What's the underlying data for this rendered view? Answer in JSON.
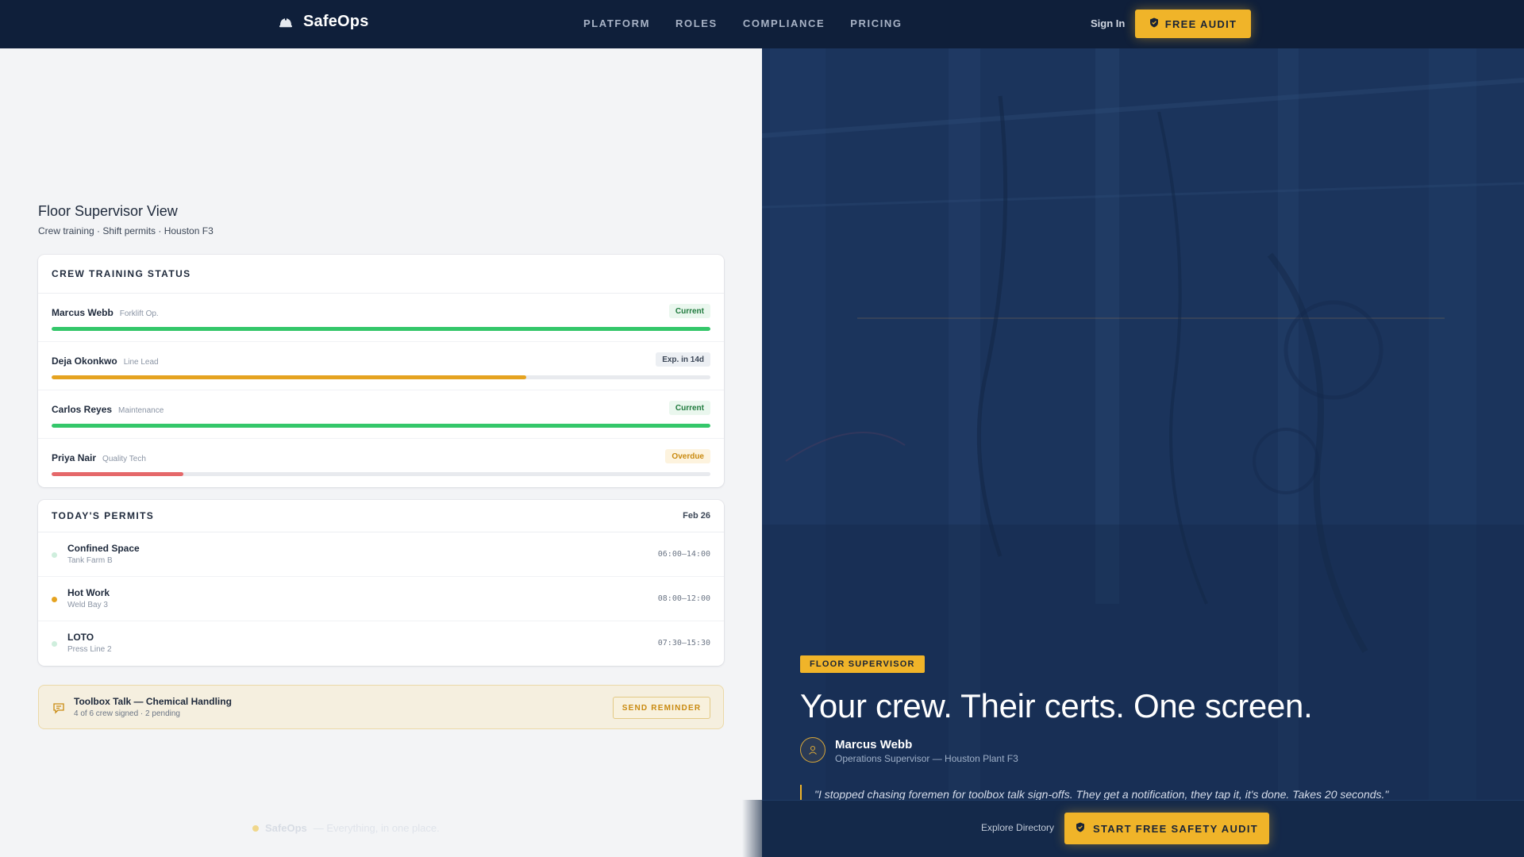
{
  "nav": {
    "brand": "SafeOps",
    "links": [
      "PLATFORM",
      "ROLES",
      "COMPLIANCE",
      "PRICING"
    ],
    "sign_in": "Sign In",
    "cta": "FREE AUDIT"
  },
  "view": {
    "title": "Floor Supervisor View",
    "subtitle": "Crew training · Shift permits · Houston F3"
  },
  "training": {
    "title": "CREW TRAINING STATUS",
    "rows": [
      {
        "name": "Marcus Webb",
        "role": "Forklift Op.",
        "status": "Current",
        "progress": 100
      },
      {
        "name": "Deja Okonkwo",
        "role": "Line Lead",
        "status": "Exp. in 14d",
        "progress": 72
      },
      {
        "name": "Carlos Reyes",
        "role": "Maintenance",
        "status": "Current",
        "progress": 100
      },
      {
        "name": "Priya Nair",
        "role": "Quality Tech",
        "status": "Overdue",
        "progress": 20
      }
    ]
  },
  "permits": {
    "title": "TODAY'S PERMITS",
    "date": "Feb 26",
    "rows": [
      {
        "name": "Confined Space",
        "location": "Tank Farm B",
        "time": "06:00–14:00"
      },
      {
        "name": "Hot Work",
        "location": "Weld Bay 3",
        "time": "08:00–12:00"
      },
      {
        "name": "LOTO",
        "location": "Press Line 2",
        "time": "07:30–15:30"
      }
    ]
  },
  "toolbox": {
    "title": "Toolbox Talk — Chemical Handling",
    "subtitle": "4 of 6 crew signed · 2 pending",
    "button": "SEND REMINDER"
  },
  "footer_left": {
    "brand": "SafeOps",
    "text": "— Everything, in one place."
  },
  "hero": {
    "tag": "FLOOR SUPERVISOR",
    "headline": "Your crew. Their certs. One screen.",
    "person_name": "Marcus Webb",
    "person_title": "Operations Supervisor — Houston Plant F3",
    "quote": "\"I stopped chasing foremen for toolbox talk sign-offs. They get a notification, they tap it, it's done. Takes 20 seconds.\""
  },
  "bottom": {
    "explore": "Explore Directory",
    "cta": "START FREE SAFETY AUDIT"
  },
  "colors": {
    "accent": "#f0b429",
    "navy": "#0f1f3a",
    "green": "#34c76a",
    "amber": "#e5a320",
    "red": "#e5686a"
  },
  "icons": {
    "brand": "hard-hat-icon",
    "cta": "shield-icon",
    "toolbox": "chat-bubble-icon",
    "avatar": "user-icon"
  }
}
